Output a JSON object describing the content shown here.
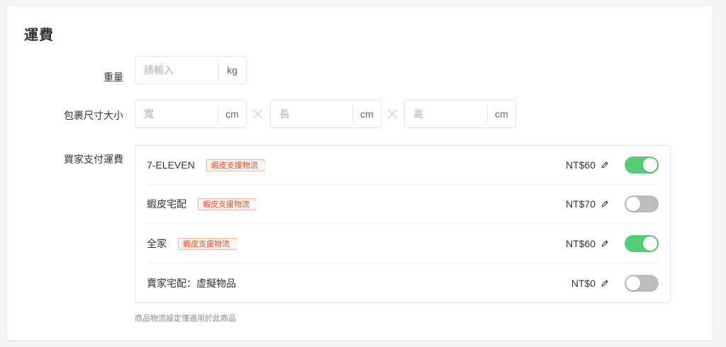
{
  "section": {
    "title": "運費"
  },
  "weight": {
    "label": "重量",
    "placeholder": "請輸入",
    "unit": "kg"
  },
  "package_size": {
    "label": "包裹尺寸大小",
    "width": {
      "placeholder": "寬",
      "unit": "cm"
    },
    "length": {
      "placeholder": "長",
      "unit": "cm"
    },
    "height": {
      "placeholder": "高",
      "unit": "cm"
    }
  },
  "shipping": {
    "label": "買家支付運費",
    "items": [
      {
        "name": "7-ELEVEN",
        "tag": "蝦皮支援物流",
        "price": "NT$60",
        "enabled": true
      },
      {
        "name": "蝦皮宅配",
        "tag": "蝦皮支援物流",
        "price": "NT$70",
        "enabled": false
      },
      {
        "name": "全家",
        "tag": "蝦皮支援物流",
        "price": "NT$60",
        "enabled": true
      },
      {
        "name": "賣家宅配：虛擬物品",
        "tag": "",
        "price": "NT$0",
        "enabled": false
      }
    ]
  },
  "footnote": "商品物流設定僅適用於此商品",
  "colors": {
    "toggle_on": "#55cc77",
    "toggle_off": "#bdbdbd",
    "tag_accent": "#ee4d2d"
  },
  "icons": {
    "edit": "pencil-icon",
    "multiply": "times-icon"
  }
}
